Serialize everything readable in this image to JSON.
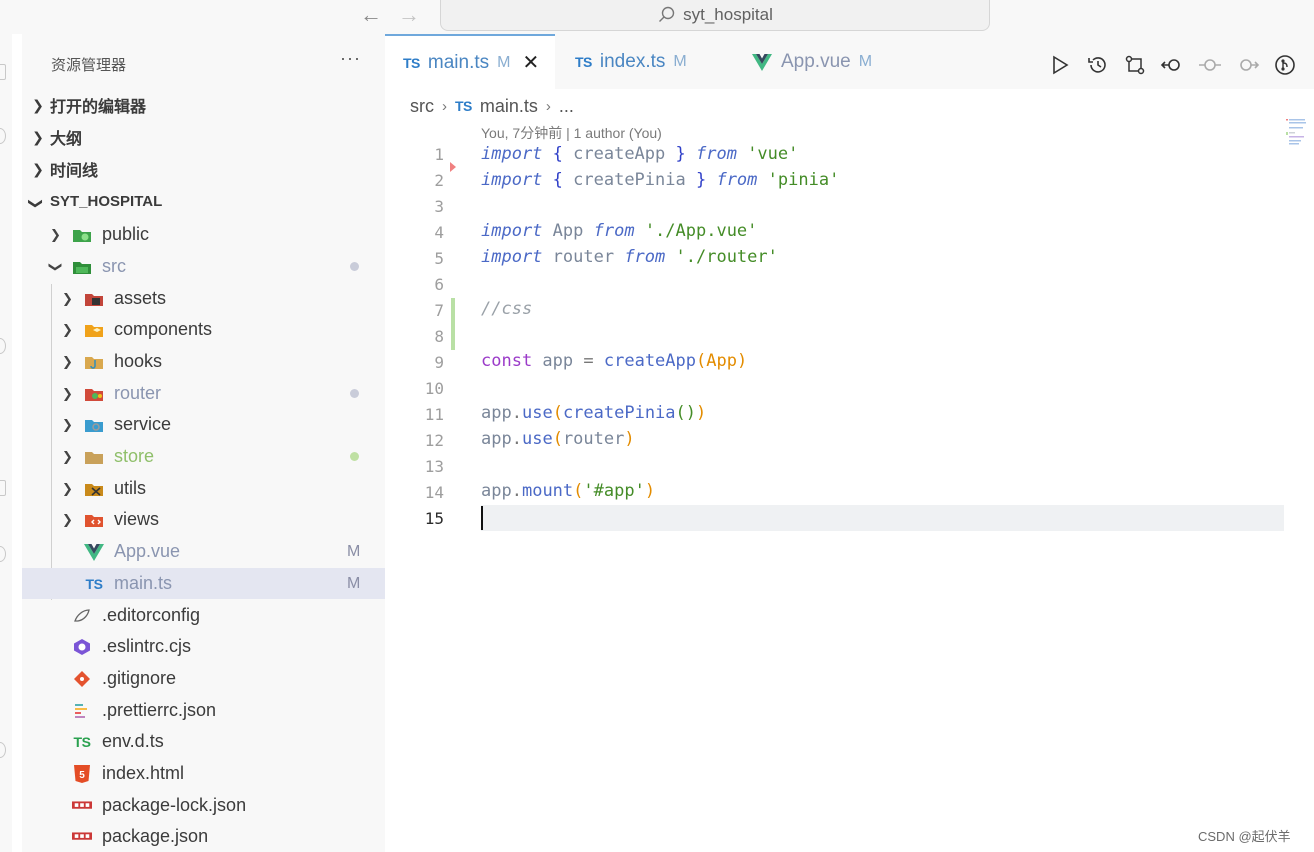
{
  "titlebar": {
    "search_text": "syt_hospital"
  },
  "sidebar": {
    "title": "资源管理器",
    "more": "···",
    "sections": [
      {
        "label": "打开的编辑器"
      },
      {
        "label": "大纲"
      },
      {
        "label": "时间线"
      },
      {
        "label": "SYT_HOSPITAL"
      }
    ],
    "tree": [
      {
        "label": "public",
        "color": "#3b3b3b"
      },
      {
        "label": "src",
        "color": "#8a95b0"
      },
      {
        "label": "assets",
        "color": "#3b3b3b"
      },
      {
        "label": "components",
        "color": "#3b3b3b"
      },
      {
        "label": "hooks",
        "color": "#3b3b3b"
      },
      {
        "label": "router",
        "color": "#8a95b0"
      },
      {
        "label": "service",
        "color": "#3b3b3b"
      },
      {
        "label": "store",
        "color": "#8fbf6a"
      },
      {
        "label": "utils",
        "color": "#3b3b3b"
      },
      {
        "label": "views",
        "color": "#3b3b3b"
      },
      {
        "label": "App.vue",
        "color": "#8a95b0",
        "badge": "M"
      },
      {
        "label": "main.ts",
        "color": "#8a95b0",
        "badge": "M"
      },
      {
        "label": ".editorconfig",
        "color": "#3b3b3b"
      },
      {
        "label": ".eslintrc.cjs",
        "color": "#3b3b3b"
      },
      {
        "label": ".gitignore",
        "color": "#3b3b3b"
      },
      {
        "label": ".prettierrc.json",
        "color": "#3b3b3b"
      },
      {
        "label": "env.d.ts",
        "color": "#3b3b3b"
      },
      {
        "label": "index.html",
        "color": "#3b3b3b"
      },
      {
        "label": "package-lock.json",
        "color": "#3b3b3b"
      },
      {
        "label": "package.json",
        "color": "#3b3b3b"
      }
    ]
  },
  "tabs": [
    {
      "icon": "TS",
      "name": "main.ts",
      "mod": "M",
      "close": "✕"
    },
    {
      "icon": "TS",
      "name": "index.ts",
      "mod": "M"
    },
    {
      "name": "App.vue",
      "mod": "M"
    }
  ],
  "breadcrumb": {
    "folder": "src",
    "sep": "›",
    "file_icon": "TS",
    "file": "main.ts",
    "tail": "..."
  },
  "editor": {
    "blame": "You, 7分钟前 | 1 author (You)",
    "line_numbers": [
      "1",
      "2",
      "3",
      "4",
      "5",
      "6",
      "7",
      "8",
      "9",
      "10",
      "11",
      "12",
      "13",
      "14",
      "15"
    ],
    "current_line": 15,
    "code": {
      "l1": [
        "import",
        " { ",
        "createApp",
        " } ",
        "from",
        " ",
        "'vue'"
      ],
      "l2": [
        "import",
        " { ",
        "createPinia",
        " } ",
        "from",
        " ",
        "'pinia'"
      ],
      "l4": [
        "import",
        " App ",
        "from",
        " ",
        "'./App.vue'"
      ],
      "l5": [
        "import",
        " router ",
        "from",
        " ",
        "'./router'"
      ],
      "l7": [
        "//css"
      ],
      "l9": [
        "const",
        " app ",
        "=",
        " ",
        "createApp",
        "(",
        "App",
        ")"
      ],
      "l11": [
        "app",
        ".",
        "use",
        "(",
        "createPinia",
        "(",
        ")",
        ")"
      ],
      "l12": [
        "app",
        ".",
        "use",
        "(",
        "router",
        ")"
      ],
      "l14": [
        "app",
        ".",
        "mount",
        "(",
        "'#app'",
        ")"
      ]
    }
  },
  "watermark": "CSDN @起伏羊",
  "colors": {
    "accent": "#6fa8dc",
    "modified": "#8a95b0",
    "untracked_dot": "#bfe0a3",
    "ts_blue": "#2e7dc8"
  }
}
